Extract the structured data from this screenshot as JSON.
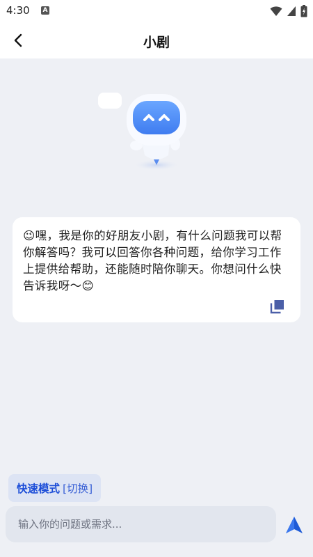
{
  "status_bar": {
    "time": "4:30",
    "notification_badge": "A",
    "icons": [
      "wifi-icon",
      "signal-icon",
      "battery-icon"
    ]
  },
  "header": {
    "title": "小剧",
    "back_icon": "chevron-left-icon"
  },
  "mascot": {
    "icon": "robot-mascot"
  },
  "message": {
    "text": "😉嘿，我是你的好朋友小剧，有什么问题我可以帮你解答吗？我可以回答你各种问题，给你学习工作上提供给帮助，还能随时陪你聊天。你想问什么快告诉我呀～😊",
    "copy_icon": "copy-icon"
  },
  "mode": {
    "label": "快速模式",
    "switch_label": "[切换]"
  },
  "input": {
    "placeholder": "输入你的问题或需求...",
    "value": ""
  },
  "send": {
    "icon": "send-icon"
  },
  "colors": {
    "background": "#eef0f5",
    "accent": "#1d4ed8",
    "card": "#ffffff",
    "chip": "#dde4f4",
    "input": "#e2e6ee"
  }
}
